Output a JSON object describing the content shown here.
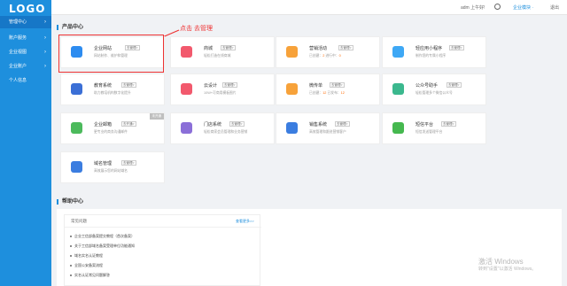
{
  "app": {
    "logo": "LOGO"
  },
  "sidebar": {
    "items": [
      {
        "label": "管理中心"
      },
      {
        "label": "账户服务"
      },
      {
        "label": "企业视图"
      },
      {
        "label": "企业账户"
      },
      {
        "label": "个人信息"
      }
    ]
  },
  "topbar": {
    "user": "adm 上午好!",
    "console": "企业模块 ·",
    "logout": "退出"
  },
  "products": {
    "section_title": "产品中心",
    "annotation": "点击 去管理",
    "cards": [
      {
        "title": "企业网站",
        "tag": "去管理>",
        "desc": "网站制作、维护和管理",
        "color": "#2d8cf0"
      },
      {
        "title": "商城",
        "tag": "去管理>",
        "desc": "轻松打造在线商城",
        "color": "#f2596d"
      },
      {
        "title": "营销活动",
        "tag": "去管理>",
        "desc_prefix": "已创建：",
        "count1": "2",
        "desc_mid": "进行中：",
        "count2": "0",
        "color": "#f7a23a"
      },
      {
        "title": "轻应用小程序",
        "tag": "去管理>",
        "desc": "制作您的专属小程序",
        "color": "#3ea8f5"
      },
      {
        "title": "教育系统",
        "tag": "去管理>",
        "desc": "助力教培机构数字化提升",
        "color": "#3b6fd6"
      },
      {
        "title": "云设计",
        "tag": "去管理>",
        "desc": "10W+可商用模板图片",
        "color": "#f2596d"
      },
      {
        "title": "微传单",
        "tag": "去管理>",
        "desc_prefix": "已创建：",
        "count1": "12",
        "desc_mid": "已发布：",
        "count2": "12",
        "color": "#f7a23a"
      },
      {
        "title": "公众号助手",
        "tag": "去管理>",
        "desc": "轻松管理多个微信公众号",
        "color": "#3bb88e"
      },
      {
        "title": "企业邮箱",
        "tag": "去开通>",
        "desc": "更专业的商务沟通邮件",
        "color": "#4cba5c",
        "badge": "未开通"
      },
      {
        "title": "门店系统",
        "tag": "去管理>",
        "desc": "轻松商家会员管理和业务营销",
        "color": "#8b6fd8"
      },
      {
        "title": "销售系统",
        "tag": "去管理>",
        "desc": "高效管理和跟进营销客户",
        "color": "#3b7de0"
      },
      {
        "title": "短信平台",
        "tag": "去管理>",
        "desc": "短信发送管理平台",
        "color": "#45b84f"
      },
      {
        "title": "域名管理",
        "tag": "去管理>",
        "desc": "高效展示您的网站域名",
        "color": "#3b7de0"
      }
    ]
  },
  "help": {
    "section_title": "帮助中心",
    "box_title": "常见问题",
    "more": "查看更多>>",
    "items": [
      "企业工信部备案提交教程（首次备案）",
      "关于工信部域名备案受理单位功能通知",
      "域名实名认证教程",
      "全国公安备案流程",
      "实名认证常见问题解答"
    ]
  },
  "watermark": {
    "line1": "激活 Windows",
    "line2": "转到\"设置\"以激活 Windows。"
  }
}
